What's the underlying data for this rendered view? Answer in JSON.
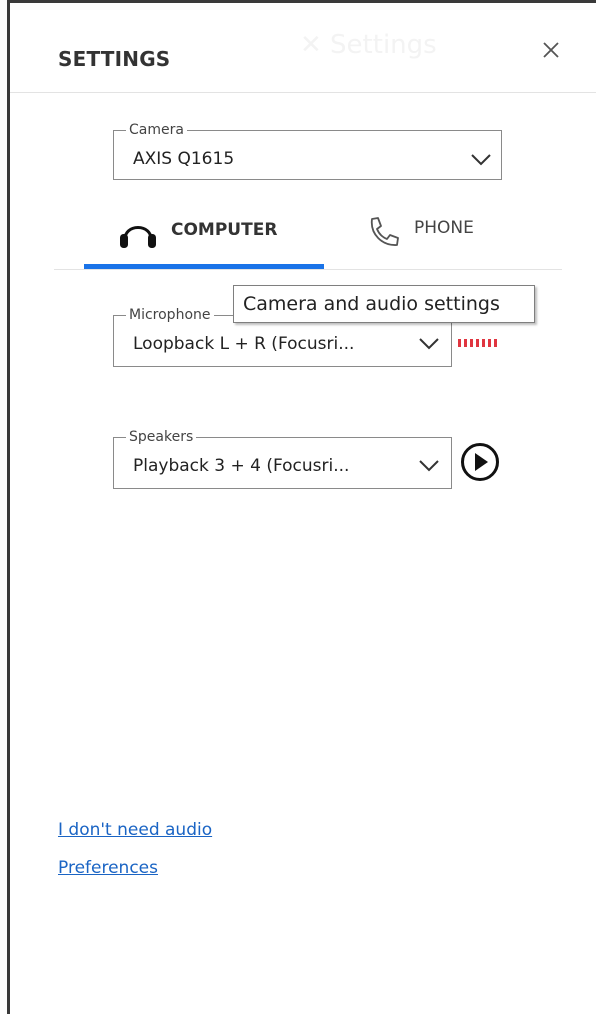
{
  "header": {
    "title": "SETTINGS"
  },
  "camera": {
    "legend": "Camera",
    "value": "AXIS Q1615"
  },
  "tabs": [
    {
      "label": "COMPUTER",
      "selected": true
    },
    {
      "label": "PHONE",
      "selected": false
    }
  ],
  "microphone": {
    "legend": "Microphone",
    "value": "Loopback L + R (Focusri...",
    "level_meter": 0
  },
  "tooltip": {
    "text": "Camera and audio settings"
  },
  "speakers": {
    "legend": "Speakers",
    "value": "Playback 3 + 4 (Focusri..."
  },
  "links": {
    "no_audio": "I don't need audio",
    "preferences": "Preferences"
  },
  "colors": {
    "accent": "#1a73e8",
    "link": "#1a64c4",
    "meter": "#e03540"
  }
}
